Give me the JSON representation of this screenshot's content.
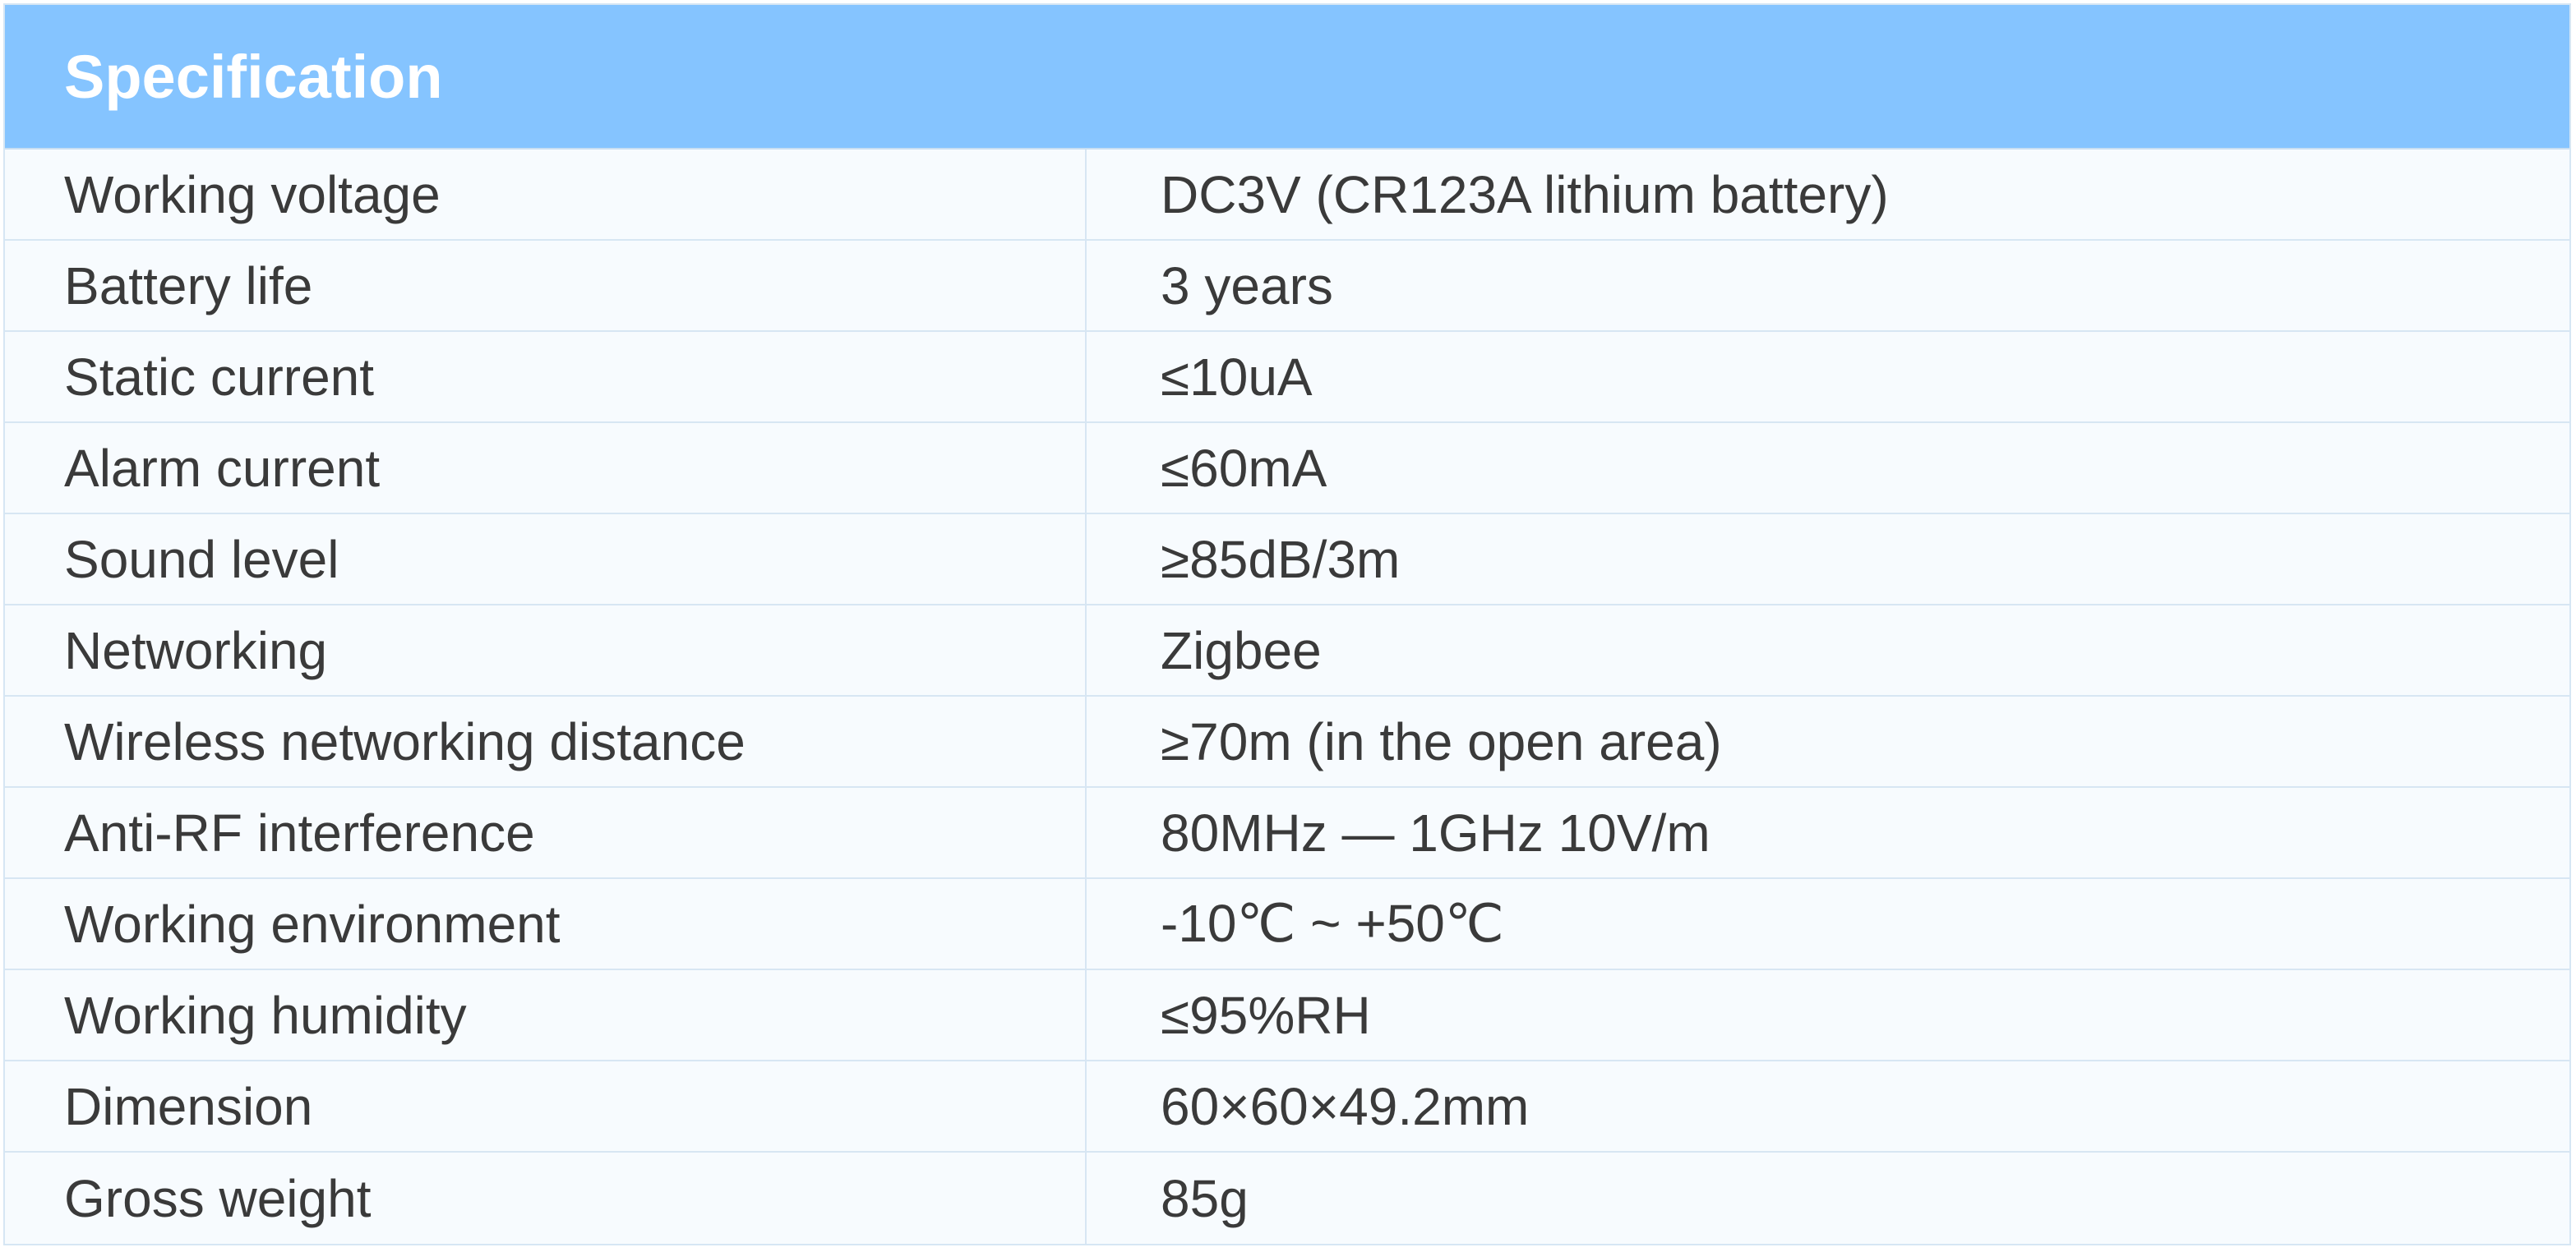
{
  "title": "Specification",
  "rows": [
    {
      "label": "Working voltage",
      "value": "DC3V (CR123A lithium battery)"
    },
    {
      "label": "Battery life",
      "value": "3 years"
    },
    {
      "label": "Static current",
      "value": "≤10uA"
    },
    {
      "label": "Alarm current",
      "value": "≤60mA"
    },
    {
      "label": "Sound level",
      "value": "≥85dB/3m"
    },
    {
      "label": "Networking",
      "value": "Zigbee"
    },
    {
      "label": "Wireless networking distance",
      "value": "≥70m (in the open area)"
    },
    {
      "label": "Anti-RF interference",
      "value": "80MHz — 1GHz 10V/m"
    },
    {
      "label": "Working environment",
      "value": "-10℃ ~ +50℃"
    },
    {
      "label": "Working humidity",
      "value": "≤95%RH"
    },
    {
      "label": "Dimension",
      "value": "60×60×49.2mm"
    },
    {
      "label": "Gross weight",
      "value": "85g"
    }
  ],
  "colors": {
    "header": "#85c4ff",
    "border": "#d7e6f3",
    "text": "#3a3a3a",
    "background": "#f7fbfe"
  }
}
